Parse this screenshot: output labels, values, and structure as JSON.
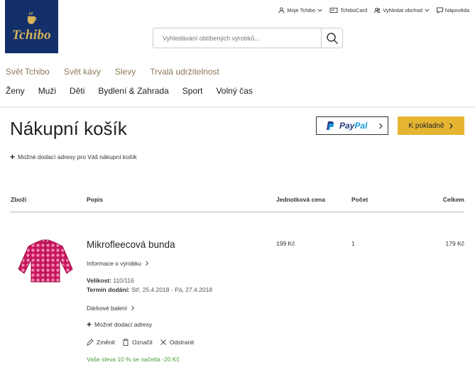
{
  "logo": {
    "brand": "Tchibo"
  },
  "util_nav": [
    {
      "label": "Moje Tchibo",
      "icon": "user-icon"
    },
    {
      "label": "TchiboCard",
      "icon": "card-icon"
    },
    {
      "label": "Vyhledat obchod",
      "icon": "store-icon"
    },
    {
      "label": "Nápověda",
      "icon": "chat-icon"
    }
  ],
  "search": {
    "placeholder": "Vyhledávání oblíbených výrobků..."
  },
  "nav_primary": [
    "Svět Tchibo",
    "Svět kávy",
    "Slevy",
    "Trvalá udržitelnost"
  ],
  "nav_secondary": [
    "Ženy",
    "Muži",
    "Děti",
    "Bydlení & Zahrada",
    "Sport",
    "Volný čas"
  ],
  "cart": {
    "title": "Nákupní košík",
    "paypal": {
      "pay": "Pay",
      "pal": "Pal"
    },
    "checkout_label": "K pokladně",
    "delivery_addresses": "Možné dodací adresy pro Váš nákupní košík",
    "columns": {
      "item": "Zboží",
      "description": "Popis",
      "unit_price": "Jednotková cena",
      "quantity": "Počet",
      "total": "Celkem"
    },
    "product": {
      "name": "Mikrofleecová bunda",
      "info_link": "Informace o výrobku",
      "size_label": "Velikost:",
      "size_value": "110/116",
      "delivery_label": "Termín dodání:",
      "delivery_value": "Stř, 25.4.2018 - Pá, 27.4.2018",
      "gift_wrap": "Dárkové balení",
      "addresses": "Možné dodací adresy",
      "actions": {
        "edit": "Změnit",
        "mark": "Označit",
        "remove": "Odstranit"
      },
      "discount": "Vaše sleva 10 % se načetla -20 Kč",
      "unit_price": "199 Kč",
      "quantity": "1",
      "total": "179 Kč"
    }
  },
  "colors": {
    "brand_blue": "#14306b",
    "brand_gold": "#d6b45a",
    "checkout": "#e5b532",
    "discount_green": "#4a9b3a",
    "jacket": "#c8175d"
  }
}
